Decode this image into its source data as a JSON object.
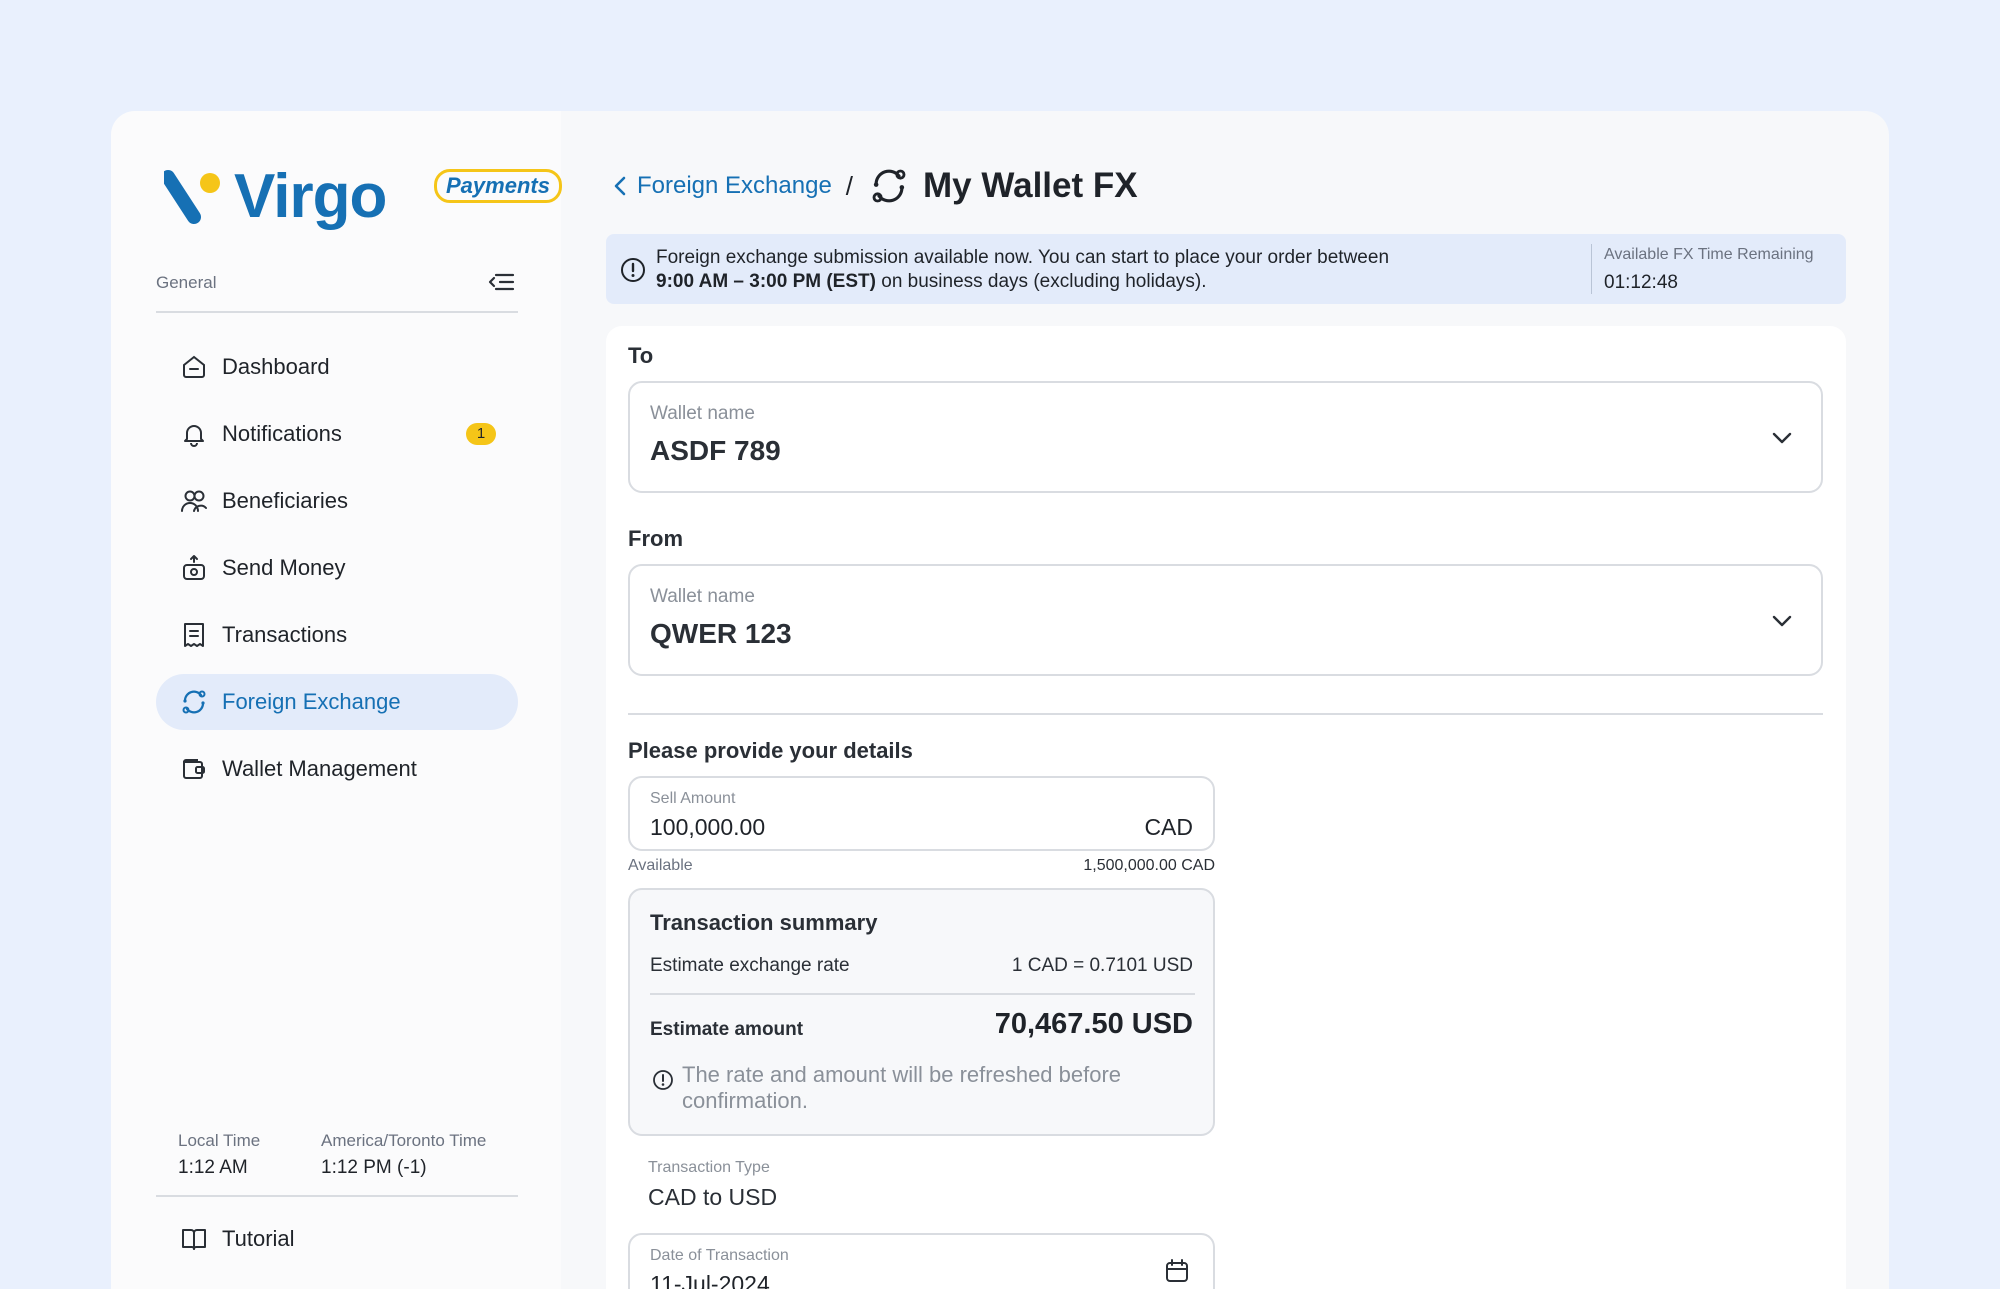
{
  "brand": {
    "name": "Virgo",
    "badge": "Payments"
  },
  "sidebar": {
    "section_label": "General",
    "items": [
      {
        "label": "Dashboard",
        "icon": "home-icon"
      },
      {
        "label": "Notifications",
        "icon": "bell-icon",
        "badge": "1"
      },
      {
        "label": "Beneficiaries",
        "icon": "users-icon"
      },
      {
        "label": "Send Money",
        "icon": "send-money-icon"
      },
      {
        "label": "Transactions",
        "icon": "receipt-icon"
      },
      {
        "label": "Foreign Exchange",
        "icon": "exchange-icon",
        "active": true
      },
      {
        "label": "Wallet Management",
        "icon": "wallet-icon"
      }
    ],
    "clock": {
      "local_label": "Local Time",
      "local_value": "1:12 AM",
      "toronto_label": "America/Toronto Time",
      "toronto_value": "1:12 PM (-1)"
    },
    "tutorial_label": "Tutorial"
  },
  "breadcrumb": {
    "parent": "Foreign Exchange",
    "separator": "/",
    "title": "My Wallet FX"
  },
  "banner": {
    "text_line1": "Foreign exchange submission available now. You can start to place your order between",
    "hours": "9:00 AM – 3:00 PM (EST)",
    "text_line2": " on business days (excluding holidays).",
    "timer_label": "Available FX Time Remaining",
    "timer_value": "01:12:48"
  },
  "form": {
    "to_title": "To",
    "to_wallet_label": "Wallet name",
    "to_wallet_value": "ASDF 789",
    "from_title": "From",
    "from_wallet_label": "Wallet name",
    "from_wallet_value": "QWER 123",
    "details_title": "Please provide your details",
    "sell_label": "Sell Amount",
    "sell_value": "100,000.00",
    "sell_currency": "CAD",
    "available_label": "Available",
    "available_value": "1,500,000.00 CAD",
    "summary": {
      "title": "Transaction summary",
      "rate_label": "Estimate exchange rate",
      "rate_value": "1 CAD = 0.7101 USD",
      "amount_label": "Estimate amount",
      "amount_value": "70,467.50 USD",
      "note": "The rate and amount will be refreshed before confirmation."
    },
    "type_label": "Transaction Type",
    "type_value": "CAD to USD",
    "date_label": "Date of Transaction",
    "date_value": "11-Jul-2024"
  },
  "colors": {
    "accent": "#1670b4",
    "badge": "#f5c518",
    "page_bg": "#e9f0fd"
  }
}
